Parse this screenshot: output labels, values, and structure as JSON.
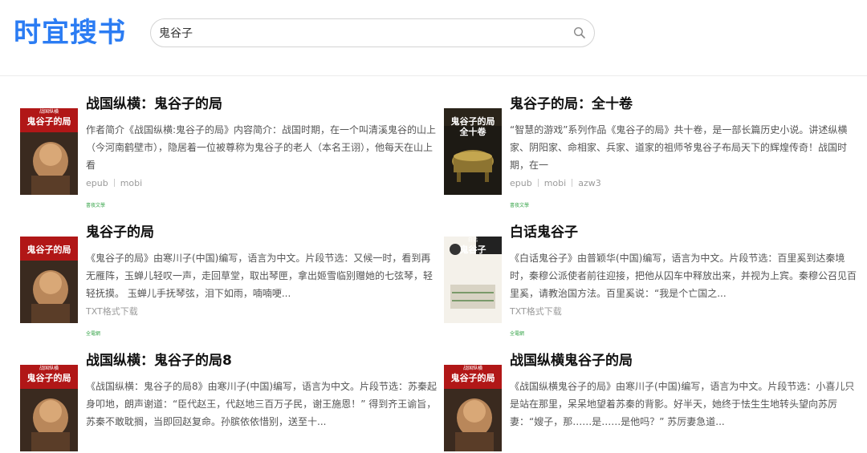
{
  "logo": {
    "text": "时宜搜书"
  },
  "search": {
    "value": "鬼谷子",
    "icon": "search-icon"
  },
  "results": [
    {
      "title": "战国纵横：鬼谷子的局",
      "desc": "作者简介《战国纵横:鬼谷子的局》内容简介：战国时期，在一个叫清溪鬼谷的山上（今河南鹤壁市），隐居着一位被尊称为鬼谷子的老人（本名王诩），他每天在山上看",
      "formats": [
        "epub",
        "mobi"
      ],
      "source": "書夜文學",
      "cover_text": "鬼谷子的局",
      "cover_top": "战国纵横",
      "cover_style": "portrait"
    },
    {
      "title": "鬼谷子的局：全十卷",
      "desc": "“智慧的游戏”系列作品《鬼谷子的局》共十卷，是一部长篇历史小说。讲述纵横家、阴阳家、命相家、兵家、道家的祖师爷鬼谷子布局天下的辉煌传奇！战国时期，在一",
      "formats": [
        "epub",
        "mobi",
        "azw3"
      ],
      "source": "書夜文學",
      "cover_text": "鬼谷子的局 全十卷",
      "cover_top": "",
      "cover_style": "bronze"
    },
    {
      "title": "鬼谷子的局",
      "desc": "《鬼谷子的局》由寒川子(中国)编写，语言为中文。片段节选：又候一时，看到再无雁阵，玉蝉儿轻叹一声，走回草堂，取出琴匣，拿出姬雪临别赠她的七弦琴，轻轻抚摸。 玉蝉儿手抚琴弦，泪下如雨，喃喃哽...",
      "formats": [
        "TXT格式下载"
      ],
      "source": "全電網",
      "cover_text": "鬼谷子的局",
      "cover_top": "",
      "cover_style": "portrait"
    },
    {
      "title": "白话鬼谷子",
      "desc": "《白话鬼谷子》由普颖华(中国)编写，语言为中文。片段节选：百里奚到达秦境时，秦穆公派使者前往迎接，把他从囚车中释放出来，并视为上宾。秦穆公召见百里奚，请教治国方法。百里奚说：“我是个亡国之...",
      "formats": [
        "TXT格式下载"
      ],
      "source": "全電網",
      "cover_text": "鬼谷子",
      "cover_top": "白话",
      "cover_style": "white"
    },
    {
      "title": "战国纵横：鬼谷子的局8",
      "desc": "《战国纵横：鬼谷子的局8》由寒川子(中国)编写，语言为中文。片段节选：苏秦起身叩地，朗声谢道：“臣代赵王，代赵地三百万子民，谢王施恩！” 得到齐王谕旨，苏秦不敢耽搁，当即回赵复命。孙膑依依惜别，送至十...",
      "formats": [],
      "source": "",
      "cover_text": "鬼谷子的局",
      "cover_top": "战国纵横",
      "cover_style": "portrait"
    },
    {
      "title": "战国纵横鬼谷子的局",
      "desc": "《战国纵横鬼谷子的局》由寒川子(中国)编写，语言为中文。片段节选：小喜儿只是站在那里，呆呆地望着苏秦的背影。好半天，她终于怯生生地转头望向苏厉妻：“嫂子，那……是……是他吗？” 苏厉妻急道...",
      "formats": [],
      "source": "",
      "cover_text": "鬼谷子的局",
      "cover_top": "战国纵横",
      "cover_style": "portrait"
    }
  ]
}
